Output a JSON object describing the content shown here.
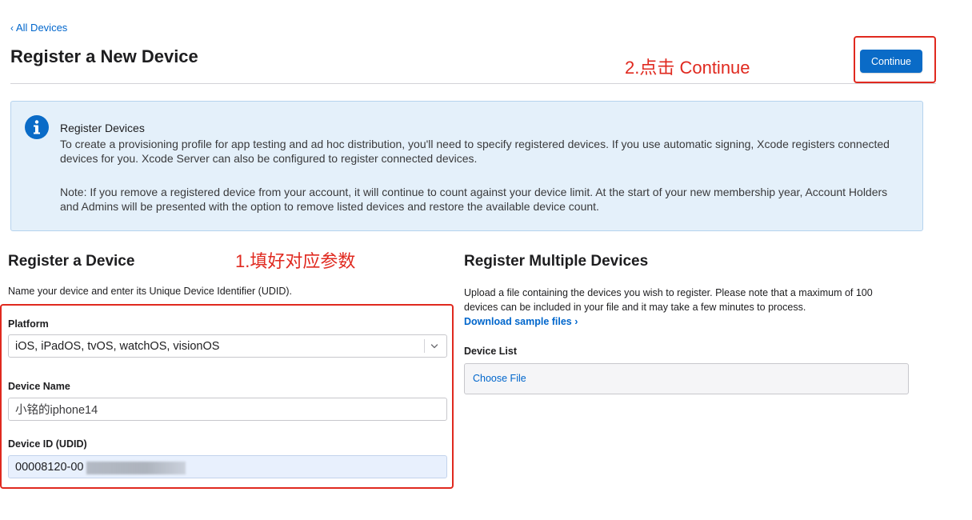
{
  "nav": {
    "back_label": "All Devices"
  },
  "header": {
    "title": "Register a New Device",
    "continue_label": "Continue"
  },
  "annotations": {
    "step1": "1.填好对应参数",
    "step2": "2.点击 Continue",
    "color": "#e0291f"
  },
  "info": {
    "icon": "info-icon",
    "heading": "Register Devices",
    "paragraph1": "To create a provisioning profile for app testing and ad hoc distribution, you'll need to specify registered devices. If you use automatic signing, Xcode registers connected devices for you. Xcode Server can also be configured to register connected devices.",
    "paragraph2": "Note: If you remove a registered device from your account, it will continue to count against your device limit. At the start of your new membership year, Account Holders and Admins will be presented with the option to remove listed devices and restore the available device count."
  },
  "register_device": {
    "title": "Register a Device",
    "description": "Name your device and enter its Unique Device Identifier (UDID).",
    "platform_label": "Platform",
    "platform_value": "iOS, iPadOS, tvOS, watchOS, visionOS",
    "device_name_label": "Device Name",
    "device_name_value": "小铭的iphone14",
    "udid_label": "Device ID (UDID)",
    "udid_value": "00008120-00"
  },
  "register_multiple": {
    "title": "Register Multiple Devices",
    "description": "Upload a file containing the devices you wish to register. Please note that a maximum of 100 devices can be included in your file and it may take a few minutes to process.",
    "download_label": "Download sample files",
    "device_list_label": "Device List",
    "choose_file_label": "Choose File"
  },
  "colors": {
    "accent": "#0a6bc7",
    "link": "#0066cc",
    "info_bg": "#e4f0fa",
    "autofill_bg": "#e8f0fd"
  }
}
